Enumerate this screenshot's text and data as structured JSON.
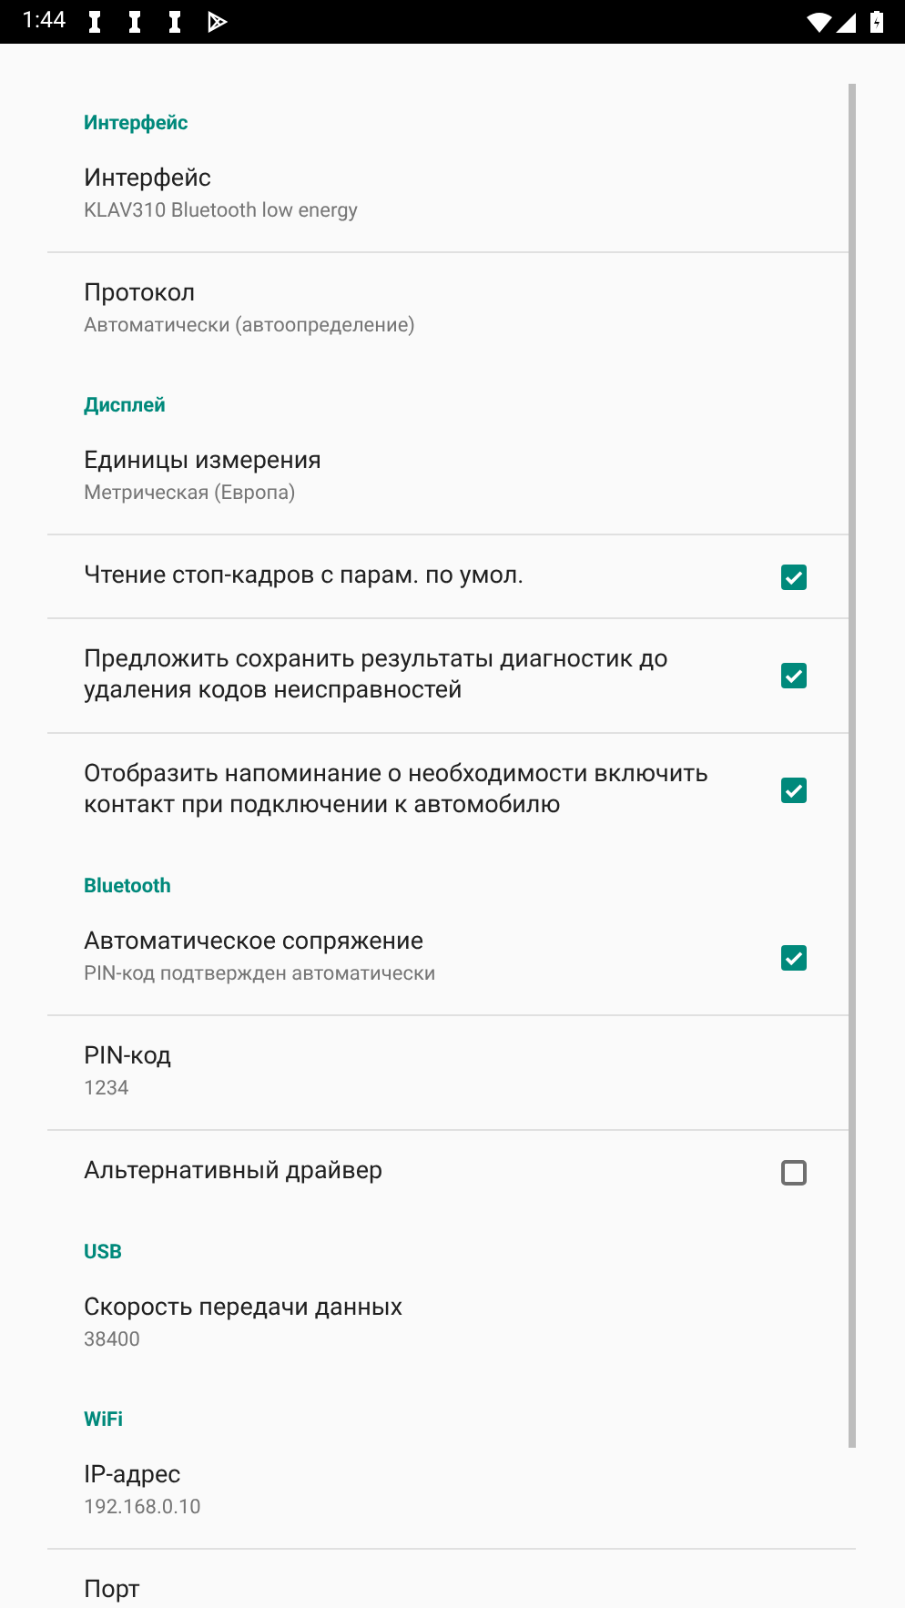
{
  "status_bar": {
    "time": "1:44"
  },
  "sections": [
    {
      "header": "Интерфейс",
      "items": [
        {
          "kind": "text",
          "title": "Интерфейс",
          "summary": "KLAV310 Bluetooth low energy"
        },
        {
          "kind": "text",
          "title": "Протокол",
          "summary": "Автоматически (автоопределение)"
        }
      ]
    },
    {
      "header": "Дисплей",
      "items": [
        {
          "kind": "text",
          "title": "Единицы измерения",
          "summary": "Метрическая (Европа)"
        },
        {
          "kind": "check",
          "title": "Чтение стоп-кадров с парам. по умол.",
          "checked": true
        },
        {
          "kind": "check",
          "title": "Предложить сохранить результаты диагностик до удаления кодов неисправностей",
          "checked": true
        },
        {
          "kind": "check",
          "title": "Отобразить напоминание о необходимости включить контакт при подключении к автомобилю",
          "checked": true
        }
      ]
    },
    {
      "header": "Bluetooth",
      "items": [
        {
          "kind": "check",
          "title": "Автоматическое сопряжение",
          "summary": "PIN-код подтвержден автоматически",
          "checked": true
        },
        {
          "kind": "text",
          "title": "PIN-код",
          "summary": "1234"
        },
        {
          "kind": "check",
          "title": "Альтернативный драйвер",
          "checked": false
        }
      ]
    },
    {
      "header": "USB",
      "items": [
        {
          "kind": "text",
          "title": "Скорость передачи данных",
          "summary": "38400"
        }
      ]
    },
    {
      "header": "WiFi",
      "items": [
        {
          "kind": "text",
          "title": "IP-адрес",
          "summary": "192.168.0.10"
        },
        {
          "kind": "text",
          "title": "Порт"
        }
      ]
    }
  ]
}
